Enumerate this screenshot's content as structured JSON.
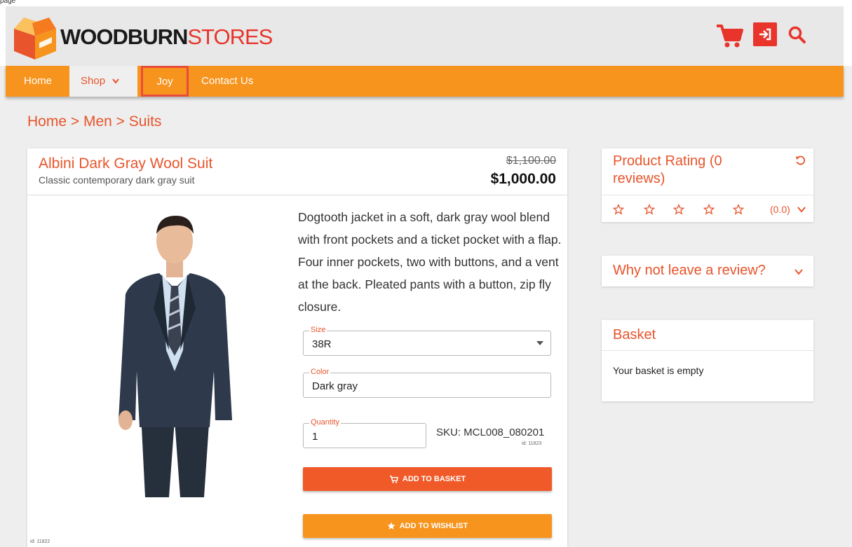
{
  "page_label": "page",
  "brand": {
    "name_bold": "WOODBURN",
    "name_light": "STORES"
  },
  "nav": {
    "home": "Home",
    "shop": "Shop",
    "joy": "Joy",
    "contact": "Contact Us"
  },
  "breadcrumb": "Home  > Men > Suits",
  "product": {
    "title": "Albini Dark Gray Wool Suit",
    "subtitle": "Classic contemporary dark gray suit",
    "old_price": "$1,100.00",
    "price": "$1,000.00",
    "description": "Dogtooth jacket in a soft, dark gray wool blend with front pockets and a ticket pocket with a flap. Four inner pockets, two with buttons, and a vent at the back. Pleated pants with a button, zip fly closure.",
    "size_label": "Size",
    "size_value": "38R",
    "color_label": "Color",
    "color_value": "Dark gray",
    "quantity_label": "Quantity",
    "quantity_value": "1",
    "sku": "SKU: MCL008_080201",
    "sku_id": "id: 11823",
    "add_to_basket": "ADD TO BASKET",
    "add_to_wishlist": "ADD TO WISHLIST",
    "product_id": "id: 11822"
  },
  "rating": {
    "title": "Product Rating (0 reviews)",
    "value": "(0.0)",
    "stars": 0,
    "max_stars": 5
  },
  "review": {
    "title": "Why not leave a review?"
  },
  "basket": {
    "title": "Basket",
    "empty_text": "Your basket is empty"
  },
  "colors": {
    "accent": "#e8542b",
    "nav_bg": "#f7941d",
    "basket_button": "#f05a28",
    "wishlist_button": "#f7941d",
    "brand_red": "#e8342b"
  }
}
